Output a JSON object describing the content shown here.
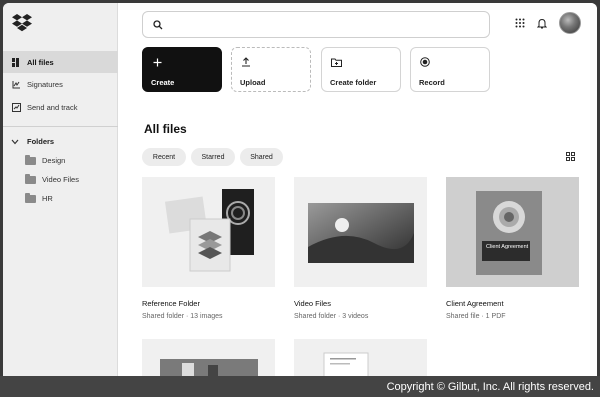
{
  "sidebar": {
    "items": [
      {
        "label": "All files",
        "icon": "all-files-icon",
        "active": true
      },
      {
        "label": "Signatures",
        "icon": "signature-icon",
        "active": false
      },
      {
        "label": "Send and track",
        "icon": "send-track-icon",
        "active": false
      }
    ],
    "folders_label": "Folders",
    "folders": [
      "Design",
      "Video Files",
      "HR"
    ]
  },
  "search": {
    "placeholder": ""
  },
  "actions": [
    {
      "label": "Create",
      "icon": "plus-icon"
    },
    {
      "label": "Upload",
      "icon": "upload-icon"
    },
    {
      "label": "Create folder",
      "icon": "folder-plus-icon"
    },
    {
      "label": "Record",
      "icon": "record-icon"
    }
  ],
  "main": {
    "title": "All files",
    "filters": [
      "Recent",
      "Starred",
      "Shared"
    ]
  },
  "files": [
    {
      "name": "Reference Folder",
      "meta": "Shared folder · 13 images"
    },
    {
      "name": "Video Files",
      "meta": "Shared folder · 3 videos"
    },
    {
      "name": "Client Agreement",
      "meta": "Shared file · 1 PDF",
      "thumb_text": "Client Agreement"
    }
  ],
  "footer": {
    "copyright": "Copyright © Gilbut, Inc. All rights reserved."
  },
  "colors": {
    "dark_button": "#111111",
    "sidebar_bg": "#efefef",
    "active_item": "#d9d9d9"
  }
}
